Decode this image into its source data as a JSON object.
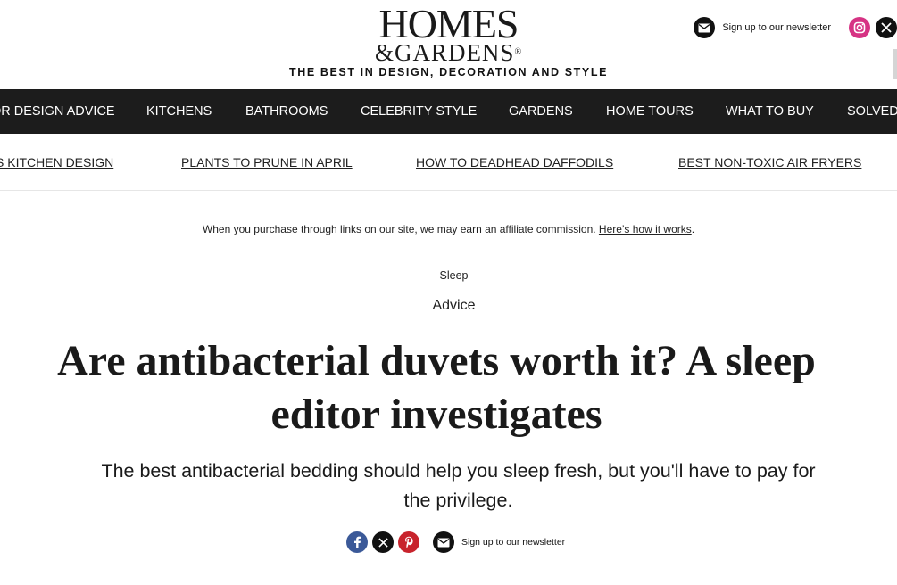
{
  "header": {
    "logo_line1": "HOMES",
    "logo_line2": "&GARDENS",
    "logo_mark": "®",
    "tagline": "THE BEST IN DESIGN, DECORATION AND STYLE",
    "newsletter_label": "Sign up to our newsletter",
    "social_icons": [
      "instagram-icon",
      "x-icon"
    ],
    "instagram_color": "#d63384"
  },
  "main_nav": {
    "items": [
      "OR DESIGN ADVICE",
      "KITCHENS",
      "BATHROOMS",
      "CELEBRITY STYLE",
      "GARDENS",
      "HOME TOURS",
      "WHAT TO BUY",
      "SOLVED"
    ],
    "background": "#1c1c1c"
  },
  "trending_nav": {
    "items": [
      "S KITCHEN DESIGN",
      "PLANTS TO PRUNE IN APRIL",
      "HOW TO DEADHEAD DAFFODILS",
      "BEST NON-TOXIC AIR FRYERS"
    ]
  },
  "article": {
    "affiliate_text": "When you purchase through links on our site, we may earn an affiliate commission.",
    "affiliate_link": "Here’s how it works",
    "affiliate_end": ".",
    "category": "Sleep",
    "subcategory": "Advice",
    "headline": "Are antibacterial duvets worth it? A sleep editor investigates",
    "standfirst": "The best antibacterial bedding should help you sleep fresh, but you'll have to pay for the privilege."
  },
  "share": {
    "icons": [
      "facebook-icon",
      "x-icon",
      "pinterest-icon"
    ],
    "colors": {
      "facebook": "#3b5998",
      "x": "#111111",
      "pinterest": "#c8232c"
    },
    "newsletter_label": "Sign up to our newsletter"
  }
}
